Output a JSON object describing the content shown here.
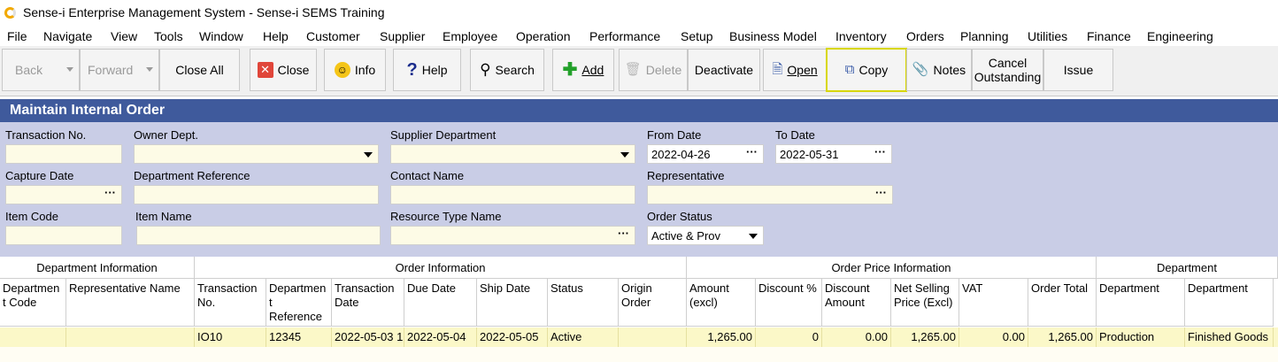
{
  "window": {
    "title": "Sense-i Enterprise Management System - Sense-i SEMS Training"
  },
  "menu": [
    "File",
    "Navigate",
    "View",
    "Tools",
    "Window",
    "Help",
    "Customer",
    "Supplier",
    "Employee",
    "Operation",
    "Performance",
    "Setup",
    "Business Model",
    "Inventory",
    "Orders",
    "Planning",
    "Utilities",
    "Finance",
    "Engineering"
  ],
  "toolbar": {
    "back": "Back",
    "forward": "Forward",
    "close_all": "Close All",
    "close": "Close",
    "info": "Info",
    "help": "Help",
    "search": "Search",
    "add": "Add",
    "delete": "Delete",
    "deactivate": "Deactivate",
    "open": "Open",
    "copy": "Copy",
    "notes": "Notes",
    "cancel_line1": "Cancel",
    "cancel_line2": "Outstanding",
    "issue": "Issue"
  },
  "form": {
    "header": "Maintain Internal Order",
    "labels": {
      "transaction_no": "Transaction No.",
      "owner_dept": "Owner Dept.",
      "supplier_dept": "Supplier Department",
      "from_date": "From Date",
      "to_date": "To Date",
      "capture_date": "Capture Date",
      "dept_reference": "Department Reference",
      "contact_name": "Contact Name",
      "representative": "Representative",
      "item_code": "Item Code",
      "item_name": "Item Name",
      "resource_type": "Resource Type Name",
      "order_status": "Order Status"
    },
    "values": {
      "from_date": "2022-04-26",
      "to_date": "2022-05-31",
      "order_status": "Active & Prov"
    }
  },
  "grid": {
    "groups": {
      "dept_info": "Department Information",
      "order_info": "Order Information",
      "order_price": "Order Price Information",
      "department": "Department"
    },
    "columns": {
      "c1": "Departmen t Code",
      "c2": "Representative Name",
      "c3": "Transaction No.",
      "c4": "Departmen t Reference",
      "c5": "Transaction Date",
      "c6": "Due Date",
      "c7": "Ship Date",
      "c8": "Status",
      "c9": "Origin Order",
      "c10": "Amount (excl)",
      "c11": "Discount %",
      "c12": "Discount Amount",
      "c13": "Net Selling Price (Excl)",
      "c14": "VAT",
      "c15": "Order Total",
      "c16": "Department",
      "c17": "Department"
    },
    "row": {
      "transaction_no": "IO10",
      "dept_reference": "12345",
      "transaction_date": "2022-05-03 1",
      "due_date": "2022-05-04",
      "ship_date": "2022-05-05",
      "status": "Active",
      "amount": "1,265.00",
      "discount_pct": "0",
      "discount_amount": "0.00",
      "net_price": "1,265.00",
      "vat": "0.00",
      "order_total": "1,265.00",
      "department": "Production",
      "department2": "Finished Goods"
    }
  }
}
